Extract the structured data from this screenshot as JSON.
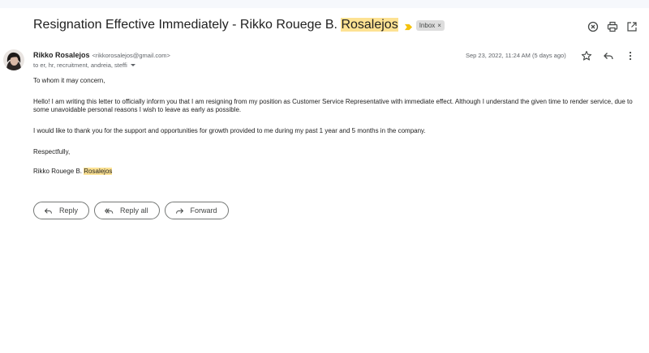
{
  "subject": {
    "before": "Resignation Effective Immediately - Rikko Rouege B. ",
    "highlight": "Rosalejos"
  },
  "label": {
    "text": "Inbox",
    "remove": "×"
  },
  "sender": {
    "name": "Rikko Rosalejos",
    "email": "<rikkorosalejos@gmail.com>",
    "to": "to er, hr, recruitment, andreia, steffi"
  },
  "date": "Sep 23, 2022, 11:24 AM (5 days ago)",
  "body": {
    "greeting": "To whom it may concern,",
    "para1": "Hello! I am writing this letter to officially inform you that I am resigning from my position as Customer Service Representative with immediate effect. Although I understand the given time to render service, due to some unavoidable personal reasons I wish to leave as early as possible.",
    "para2": "I would like to thank you for the support and opportunities for growth provided to me during my past 1 year and 5 months in the company.",
    "closing": "Respectfully,",
    "signature_before": "Rikko Rouege B. ",
    "signature_highlight": "Rosalejos"
  },
  "actions": {
    "reply": "Reply",
    "reply_all": "Reply all",
    "forward": "Forward"
  },
  "icons": [
    "important-marker-icon",
    "close-circle-icon",
    "print-icon",
    "open-new-window-icon",
    "star-icon",
    "reply-icon",
    "more-vert-icon",
    "reply-all-icon",
    "forward-icon",
    "caret-down-icon"
  ],
  "colors": {
    "highlight": "#fde293",
    "important": "#f4c20d",
    "chip": "#dddddd"
  }
}
